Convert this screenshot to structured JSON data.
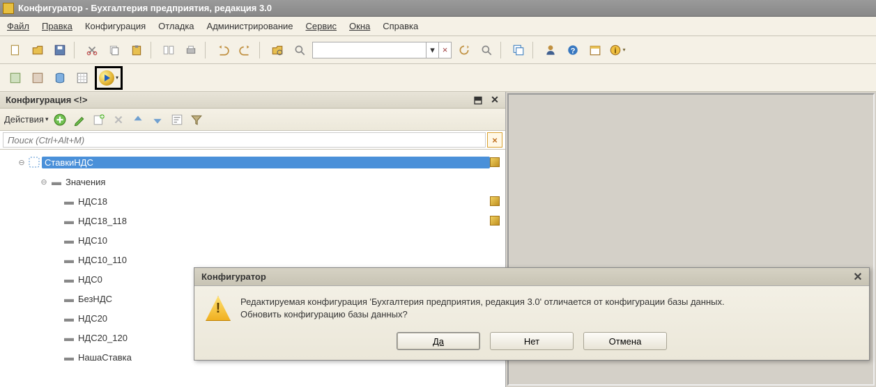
{
  "title": "Конфигуратор - Бухгалтерия предприятия, редакция 3.0",
  "menu": {
    "file": "Файл",
    "edit": "Правка",
    "config": "Конфигурация",
    "debug": "Отладка",
    "admin": "Администрирование",
    "service": "Сервис",
    "windows": "Окна",
    "help": "Справка"
  },
  "panel": {
    "title": "Конфигурация <!>",
    "actions_label": "Действия",
    "search_placeholder": "Поиск (Ctrl+Alt+M)"
  },
  "tree": {
    "root": "СтавкиНДС",
    "values_label": "Значения",
    "items": [
      "НДС18",
      "НДС18_118",
      "НДС10",
      "НДС10_110",
      "НДС0",
      "БезНДС",
      "НДС20",
      "НДС20_120",
      "НашаСтавка"
    ]
  },
  "dialog": {
    "title": "Конфигуратор",
    "line1": "Редактируемая конфигурация 'Бухгалтерия предприятия, редакция 3.0' отличается от конфигурации базы данных.",
    "line2": "Обновить конфигурацию базы данных?",
    "yes": "Да",
    "no": "Нет",
    "cancel": "Отмена"
  }
}
